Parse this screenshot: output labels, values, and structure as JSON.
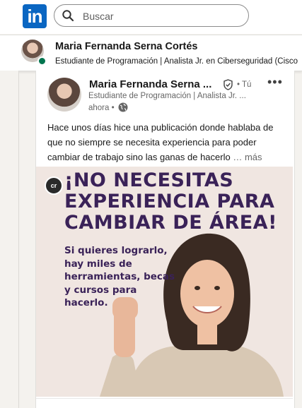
{
  "header": {
    "logo_text": "in",
    "search_placeholder": "Buscar"
  },
  "profile_bar": {
    "name": "Maria Fernanda Serna Cortés",
    "headline": "Estudiante de Programación | Analista Jr. en Ciberseguridad (Cisco"
  },
  "post": {
    "author": "Maria Fernanda Serna ...",
    "degree": "• Tú",
    "headline": "Estudiante de Programación | Analista Jr. ...",
    "time": "ahora •",
    "text": "Hace unos días hice una publicación donde hablaba de que no siempre se necesita experiencia para poder cambiar de trabajo sino las ganas de hacerlo",
    "see_more": "… más",
    "image": {
      "badge": "cr",
      "headline_lines": [
        "¡NO NECESITAS",
        "EXPERIENCIA PARA",
        "CAMBIAR DE ÁREA!"
      ],
      "subtext_lines": [
        "Si quieres lograrlo,",
        "hay miles de",
        "herramientas, becas",
        "y cursos para",
        "hacerlo."
      ]
    }
  },
  "colors": {
    "brand": "#0a66c2",
    "online": "#01754f",
    "image_text": "#3a2258"
  }
}
